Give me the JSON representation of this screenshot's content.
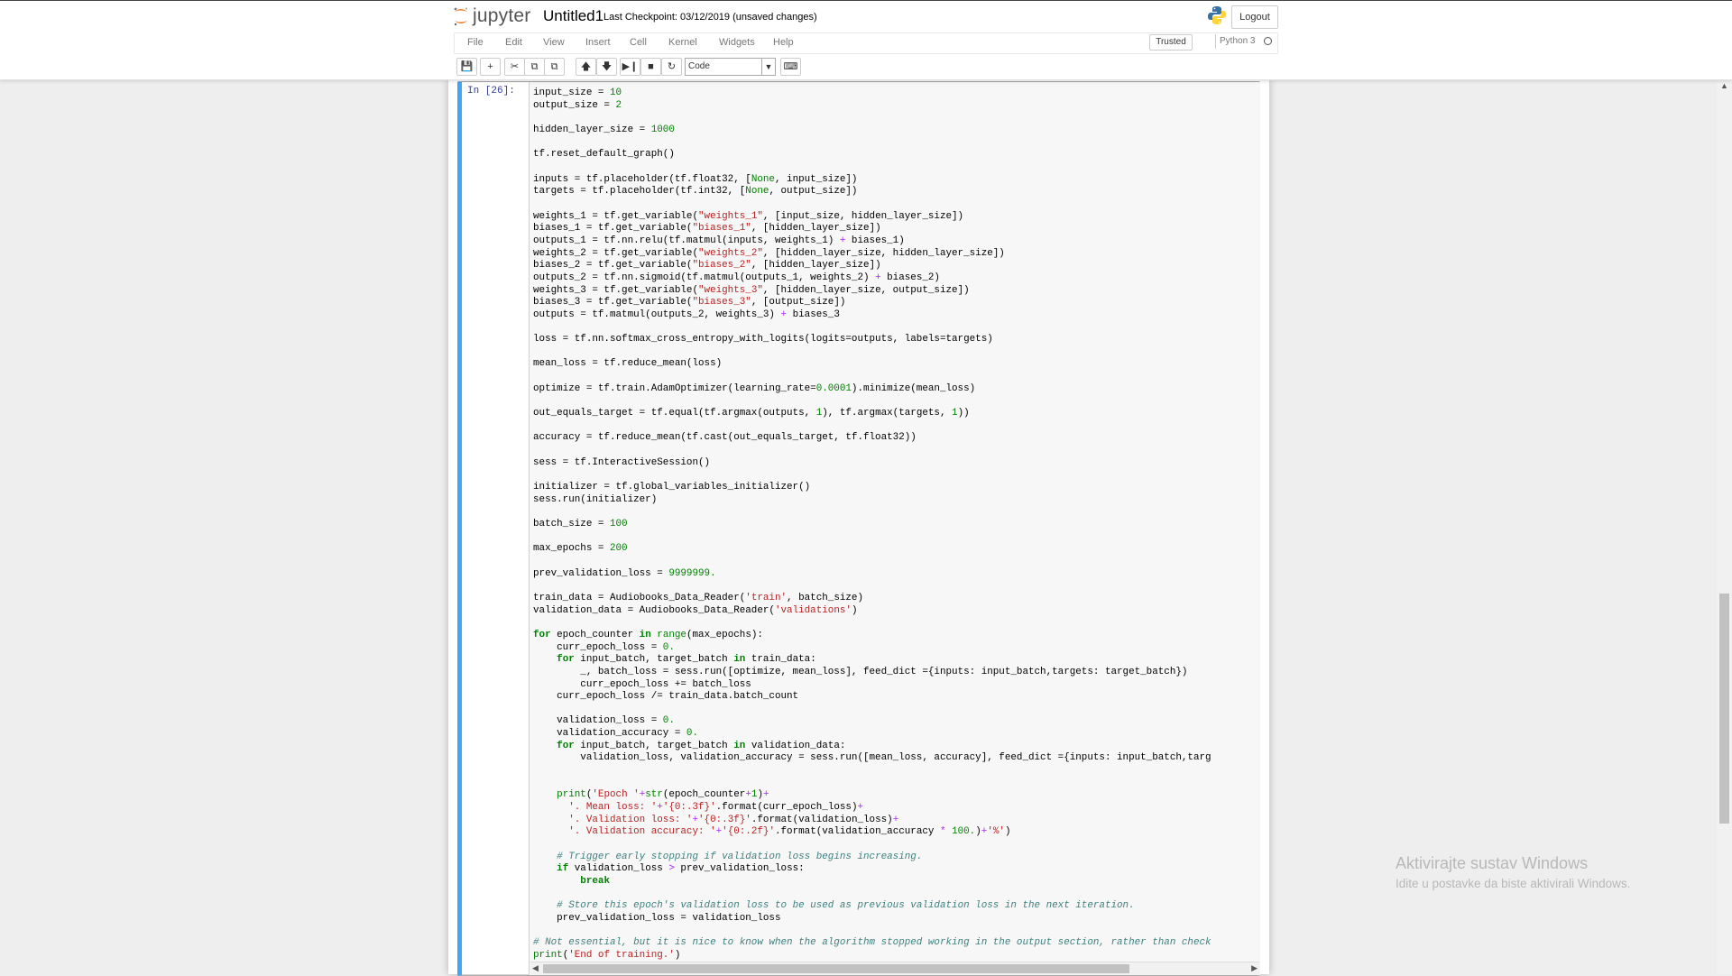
{
  "header": {
    "logo_text": "jupyter",
    "notebook_name": "Untitled1",
    "checkpoint": "Last Checkpoint: 03/12/2019 (unsaved changes)",
    "logout_label": "Logout"
  },
  "menubar": {
    "items": [
      "File",
      "Edit",
      "View",
      "Insert",
      "Cell",
      "Kernel",
      "Widgets",
      "Help"
    ],
    "trusted_label": "Trusted",
    "kernel_name": "Python 3"
  },
  "toolbar": {
    "icons": [
      "save-icon",
      "plus-icon",
      "cut-icon",
      "copy-icon",
      "paste-icon",
      "arrow-up-icon",
      "arrow-down-icon",
      "step-forward-icon",
      "stop-icon",
      "refresh-icon",
      "keyboard-icon"
    ],
    "cell_type": "Code"
  },
  "cell": {
    "prompt": "In [26]:",
    "code_lines": [
      "input_size = 10",
      "output_size = 2",
      "",
      "hidden_layer_size = 1000",
      "",
      "tf.reset_default_graph()",
      "",
      "inputs = tf.placeholder(tf.float32, [None, input_size])",
      "targets = tf.placeholder(tf.int32, [None, output_size])",
      "",
      "weights_1 = tf.get_variable(\"weights_1\", [input_size, hidden_layer_size])",
      "biases_1 = tf.get_variable(\"biases_1\", [hidden_layer_size])",
      "outputs_1 = tf.nn.relu(tf.matmul(inputs, weights_1) + biases_1)",
      "weights_2 = tf.get_variable(\"weights_2\", [hidden_layer_size, hidden_layer_size])",
      "biases_2 = tf.get_variable(\"biases_2\", [hidden_layer_size])",
      "outputs_2 = tf.nn.sigmoid(tf.matmul(outputs_1, weights_2) + biases_2)",
      "weights_3 = tf.get_variable(\"weights_3\", [hidden_layer_size, output_size])",
      "biases_3 = tf.get_variable(\"biases_3\", [output_size])",
      "outputs = tf.matmul(outputs_2, weights_3) + biases_3",
      "",
      "loss = tf.nn.softmax_cross_entropy_with_logits(logits=outputs, labels=targets)",
      "",
      "mean_loss = tf.reduce_mean(loss)",
      "",
      "optimize = tf.train.AdamOptimizer(learning_rate=0.0001).minimize(mean_loss)",
      "",
      "out_equals_target = tf.equal(tf.argmax(outputs, 1), tf.argmax(targets, 1))",
      "",
      "accuracy = tf.reduce_mean(tf.cast(out_equals_target, tf.float32))",
      "",
      "sess = tf.InteractiveSession()",
      "",
      "initializer = tf.global_variables_initializer()",
      "sess.run(initializer)",
      "",
      "batch_size = 100",
      "",
      "max_epochs = 200",
      "",
      "prev_validation_loss = 9999999.",
      "",
      "train_data = Audiobooks_Data_Reader('train', batch_size)",
      "validation_data = Audiobooks_Data_Reader('validations')",
      "",
      "for epoch_counter in range(max_epochs):",
      "    curr_epoch_loss = 0.",
      "    for input_batch, target_batch in train_data:",
      "        _, batch_loss = sess.run([optimize, mean_loss], feed_dict ={inputs: input_batch,targets: target_batch})",
      "        curr_epoch_loss += batch_loss",
      "    curr_epoch_loss /= train_data.batch_count",
      "",
      "    validation_loss = 0.",
      "    validation_accuracy = 0.",
      "    for input_batch, target_batch in validation_data:",
      "        validation_loss, validation_accuracy = sess.run([mean_loss, accuracy], feed_dict ={inputs: input_batch,targ",
      "",
      "",
      "    print('Epoch '+str(epoch_counter+1)+",
      "      '. Mean loss: '+'{0:.3f}'.format(curr_epoch_loss)+",
      "      '. Validation loss: '+'{0:.3f}'.format(validation_loss)+",
      "      '. Validation accuracy: '+'{0:.2f}'.format(validation_accuracy * 100.)+'%')",
      "",
      "    # Trigger early stopping if validation loss begins increasing.",
      "    if validation_loss > prev_validation_loss:",
      "        break",
      "",
      "    # Store this epoch's validation loss to be used as previous validation loss in the next iteration.",
      "    prev_validation_loss = validation_loss",
      "",
      "# Not essential, but it is nice to know when the algorithm stopped working in the output section, rather than check",
      "print('End of training.')"
    ]
  },
  "watermark": {
    "line1": "Aktivirajte sustav Windows",
    "line2": "Idite u postavke da biste aktivirali Windows."
  },
  "colors": {
    "cell_border_selected": "#42a5f5",
    "prompt": "#303f9f",
    "keyword": "#008000",
    "string": "#ba2121",
    "operator": "#aa22ff",
    "comment": "#408080"
  }
}
